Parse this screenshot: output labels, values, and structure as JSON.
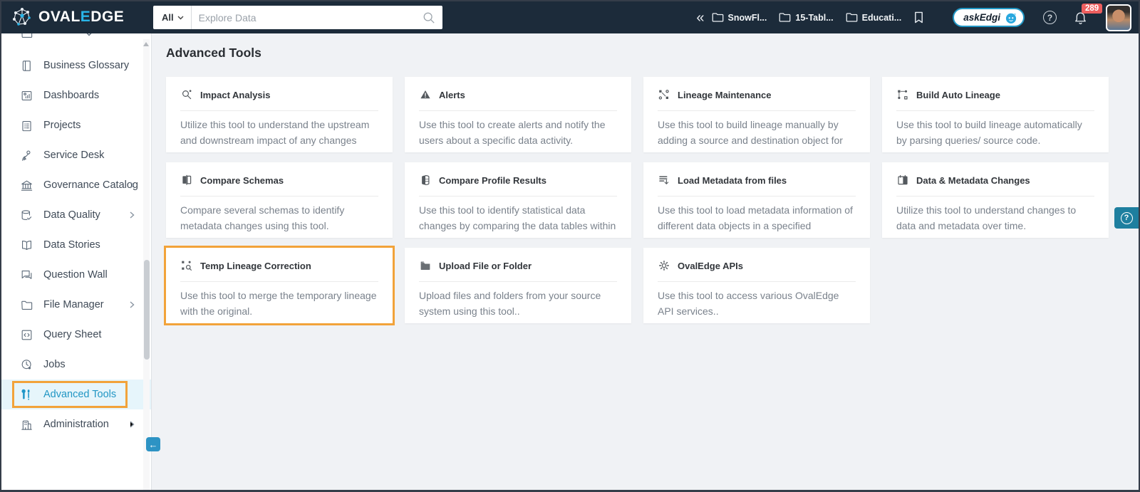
{
  "header": {
    "logo": {
      "part1": "OVAL",
      "accent": "E",
      "part2": "DGE"
    },
    "search": {
      "filter_label": "All",
      "placeholder": "Explore Data"
    },
    "recent_items": [
      {
        "label": "SnowFl..."
      },
      {
        "label": "15-Tabl..."
      },
      {
        "label": "Educati..."
      }
    ],
    "ask_edgi_label": "askEdgi",
    "notification_count": "289"
  },
  "icons": {
    "help_glyph": "?",
    "double_chevron_glyph": "«",
    "collapse_arrow_glyph": "←"
  },
  "sidebar": {
    "items": [
      {
        "label": "Business Glossary",
        "has_submenu": false
      },
      {
        "label": "Dashboards",
        "has_submenu": false
      },
      {
        "label": "Projects",
        "has_submenu": false
      },
      {
        "label": "Service Desk",
        "has_submenu": false
      },
      {
        "label": "Governance Catalog",
        "has_submenu": true
      },
      {
        "label": "Data Quality",
        "has_submenu": true
      },
      {
        "label": "Data Stories",
        "has_submenu": false
      },
      {
        "label": "Question Wall",
        "has_submenu": false
      },
      {
        "label": "File Manager",
        "has_submenu": true
      },
      {
        "label": "Query Sheet",
        "has_submenu": false
      },
      {
        "label": "Jobs",
        "has_submenu": false
      },
      {
        "label": "Advanced Tools",
        "has_submenu": false,
        "active": true
      },
      {
        "label": "Administration",
        "has_submenu": true
      }
    ]
  },
  "main": {
    "title": "Advanced Tools",
    "cards": [
      {
        "title": "Impact Analysis",
        "description": "Utilize this tool to understand the upstream and downstream impact of any changes made",
        "highlighted": false
      },
      {
        "title": "Alerts",
        "description": "Use this tool to create alerts and notify the users about a specific data activity.",
        "highlighted": false
      },
      {
        "title": "Lineage Maintenance",
        "description": "Use this tool to build lineage manually by adding a source and destination object for the",
        "highlighted": false
      },
      {
        "title": "Build Auto Lineage",
        "description": "Use this tool to build lineage automatically by parsing queries/ source code.",
        "highlighted": false
      },
      {
        "title": "Compare Schemas",
        "description": "Compare several schemas to identify metadata changes using this tool.",
        "highlighted": false
      },
      {
        "title": "Compare Profile Results",
        "description": "Use this tool to identify statistical data changes by comparing the data tables within",
        "highlighted": false
      },
      {
        "title": "Load Metadata from files",
        "description": "Use this tool to load metadata information of different data objects in a specified template..",
        "highlighted": false
      },
      {
        "title": "Data & Metadata Changes",
        "description": "Utilize this tool to understand changes to data and metadata over time.",
        "highlighted": false
      },
      {
        "title": "Temp Lineage Correction",
        "description": "Use this tool to merge the temporary lineage with the original.",
        "highlighted": true
      },
      {
        "title": "Upload File or Folder",
        "description": "Upload files and folders from your source system using this tool..",
        "highlighted": false
      },
      {
        "title": "OvalEdge APIs",
        "description": "Use this tool to access various OvalEdge API services..",
        "highlighted": false
      }
    ]
  },
  "colors": {
    "header_bg": "#1c2b3a",
    "accent_blue": "#2196c4",
    "logo_cyan": "#29b5e8",
    "highlight_orange": "#f2a33a",
    "badge_red": "#ed5f5f",
    "help_tab_teal": "#1e7f9f",
    "main_bg": "#f0f2f5",
    "card_bg": "#ffffff"
  }
}
